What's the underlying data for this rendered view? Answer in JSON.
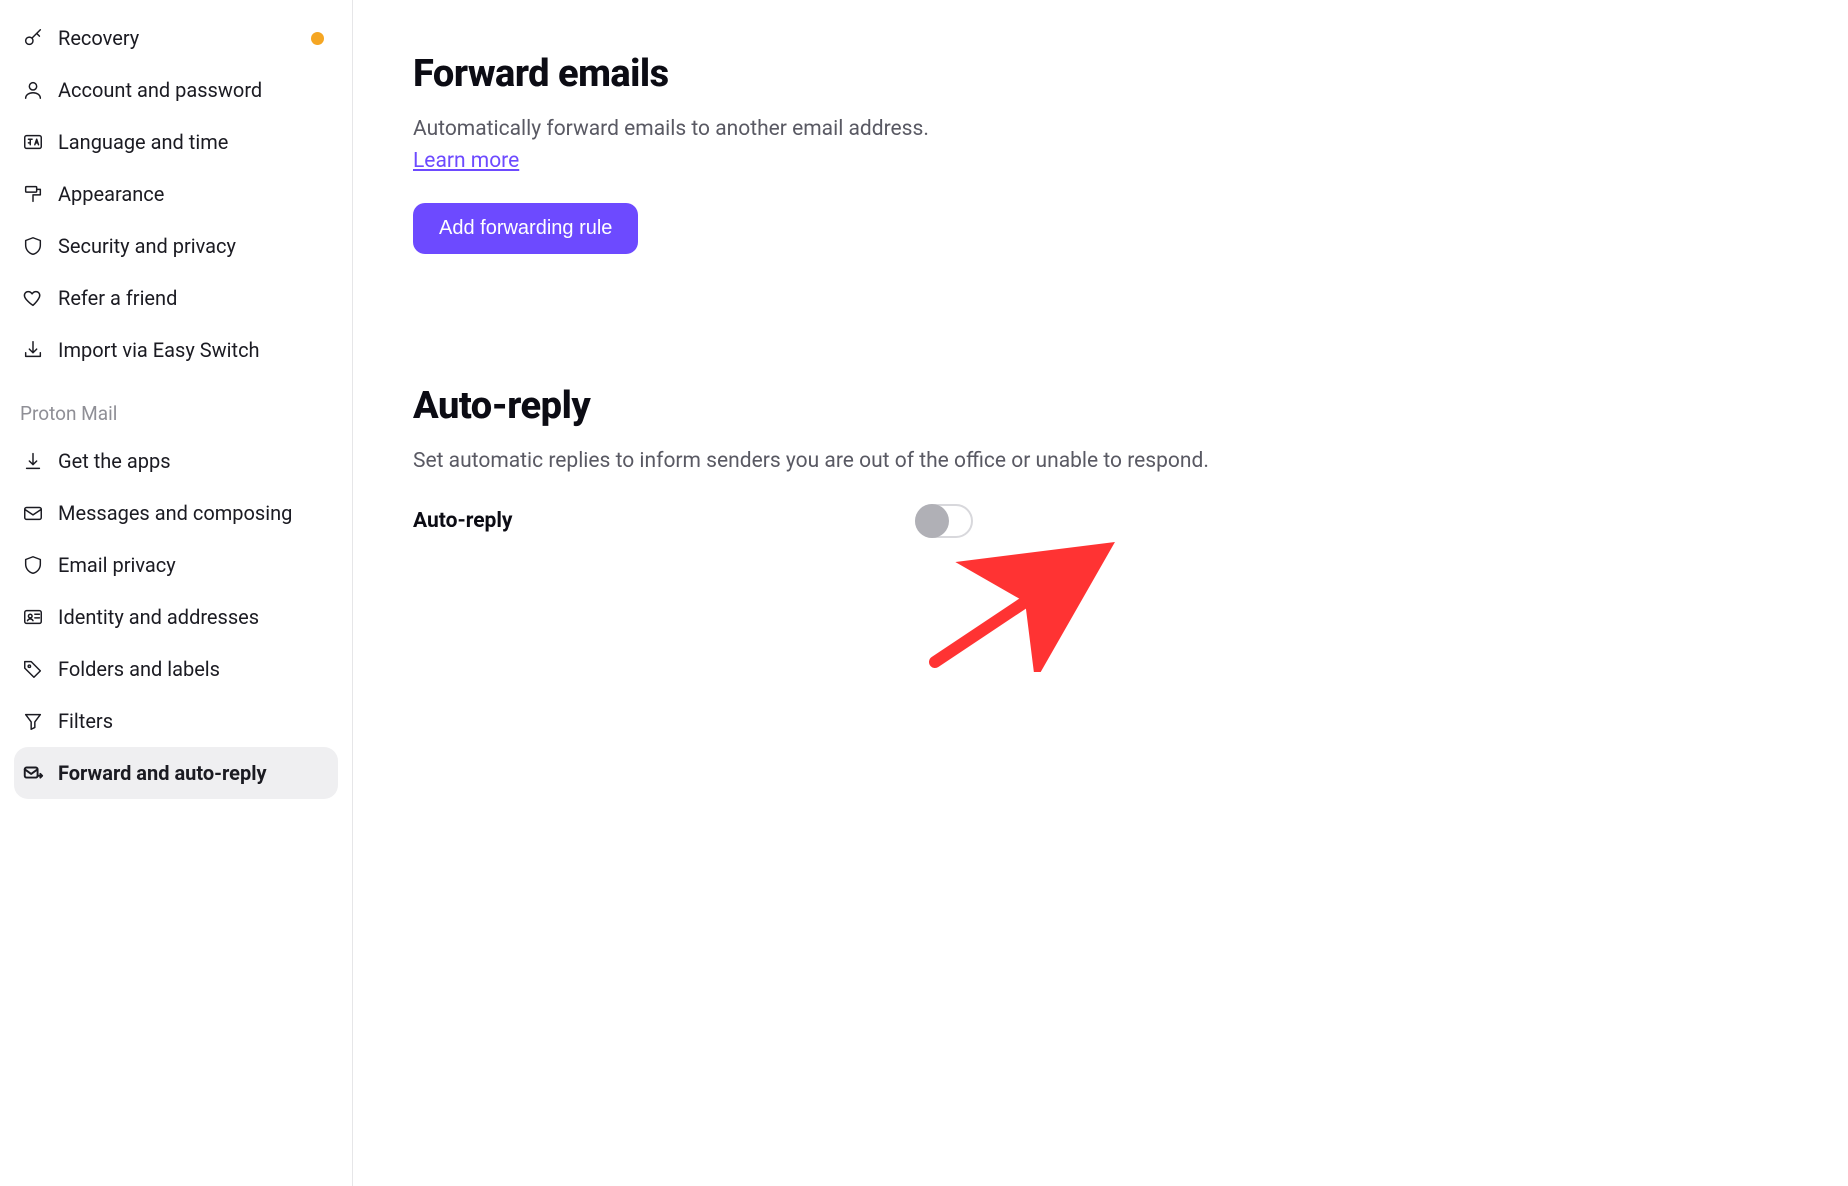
{
  "sidebar": {
    "top_items": [
      {
        "icon": "key",
        "label": "Recovery",
        "has_notif": true
      },
      {
        "icon": "user",
        "label": "Account and password"
      },
      {
        "icon": "lang",
        "label": "Language and time"
      },
      {
        "icon": "paint",
        "label": "Appearance"
      },
      {
        "icon": "shield",
        "label": "Security and privacy"
      },
      {
        "icon": "heart",
        "label": "Refer a friend"
      },
      {
        "icon": "import",
        "label": "Import via Easy Switch"
      }
    ],
    "group_label": "Proton Mail",
    "mail_items": [
      {
        "icon": "download",
        "label": "Get the apps"
      },
      {
        "icon": "envelope",
        "label": "Messages and composing"
      },
      {
        "icon": "shield",
        "label": "Email privacy"
      },
      {
        "icon": "idcard",
        "label": "Identity and addresses"
      },
      {
        "icon": "tag",
        "label": "Folders and labels"
      },
      {
        "icon": "filter",
        "label": "Filters"
      },
      {
        "icon": "forward",
        "label": "Forward and auto-reply",
        "active": true
      }
    ]
  },
  "forward_section": {
    "title": "Forward emails",
    "desc": "Automatically forward emails to another email address.",
    "learn_more": "Learn more",
    "button": "Add forwarding rule"
  },
  "autoreply_section": {
    "title": "Auto-reply",
    "desc": "Set automatic replies to inform senders you are out of the office or unable to respond.",
    "toggle_label": "Auto-reply",
    "toggle_state": false
  },
  "annotation": {
    "type": "arrow",
    "color": "#ff3333",
    "points_at": "auto-reply-toggle"
  }
}
